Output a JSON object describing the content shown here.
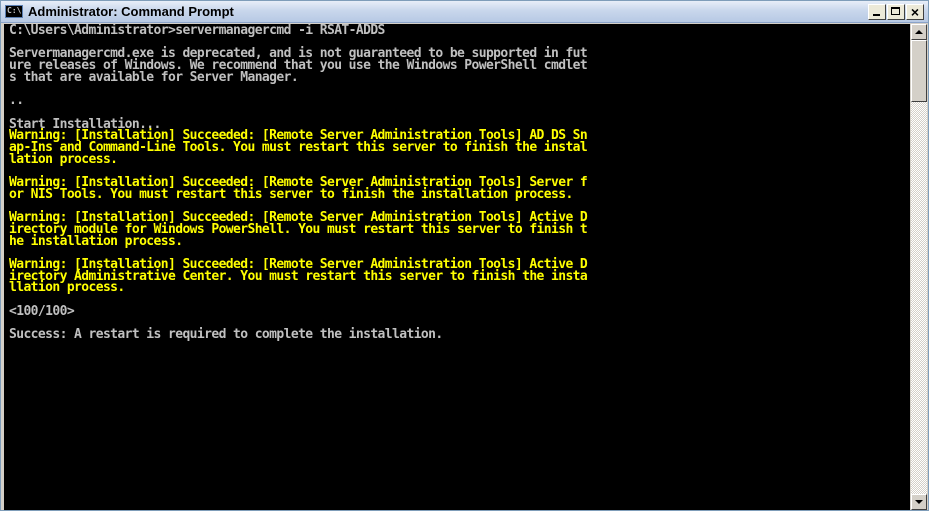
{
  "window": {
    "title": "Administrator: Command Prompt",
    "icon_text": "C:\\"
  },
  "console": {
    "lines": [
      {
        "text": "C:\\Users\\Administrator>servermanagercmd -i RSAT-ADDS",
        "color": "white"
      },
      {
        "text": "",
        "color": "white"
      },
      {
        "text": "Servermanagercmd.exe is deprecated, and is not guaranteed to be supported in fut",
        "color": "white"
      },
      {
        "text": "ure releases of Windows. We recommend that you use the Windows PowerShell cmdlet",
        "color": "white"
      },
      {
        "text": "s that are available for Server Manager.",
        "color": "white"
      },
      {
        "text": "",
        "color": "white"
      },
      {
        "text": "..",
        "color": "white"
      },
      {
        "text": "",
        "color": "white"
      },
      {
        "text": "Start Installation...",
        "color": "white"
      },
      {
        "text": "Warning: [Installation] Succeeded: [Remote Server Administration Tools] AD DS Sn",
        "color": "yellow"
      },
      {
        "text": "ap-Ins and Command-Line Tools. You must restart this server to finish the instal",
        "color": "yellow"
      },
      {
        "text": "lation process.",
        "color": "yellow"
      },
      {
        "text": "",
        "color": "white"
      },
      {
        "text": "Warning: [Installation] Succeeded: [Remote Server Administration Tools] Server f",
        "color": "yellow"
      },
      {
        "text": "or NIS Tools. You must restart this server to finish the installation process.",
        "color": "yellow"
      },
      {
        "text": "",
        "color": "white"
      },
      {
        "text": "Warning: [Installation] Succeeded: [Remote Server Administration Tools] Active D",
        "color": "yellow"
      },
      {
        "text": "irectory module for Windows PowerShell. You must restart this server to finish t",
        "color": "yellow"
      },
      {
        "text": "he installation process.",
        "color": "yellow"
      },
      {
        "text": "",
        "color": "white"
      },
      {
        "text": "Warning: [Installation] Succeeded: [Remote Server Administration Tools] Active D",
        "color": "yellow"
      },
      {
        "text": "irectory Administrative Center. You must restart this server to finish the insta",
        "color": "yellow"
      },
      {
        "text": "llation process.",
        "color": "yellow"
      },
      {
        "text": "",
        "color": "white"
      },
      {
        "text": "<100/100>",
        "color": "white"
      },
      {
        "text": "",
        "color": "white"
      },
      {
        "text": "Success: A restart is required to complete the installation.",
        "color": "white"
      }
    ]
  },
  "colors": {
    "console_bg": "#000000",
    "console_text": "#c0c0c0",
    "warning_text": "#ffff00"
  },
  "icons": {
    "window_icon": "cmd-icon",
    "minimize": "minimize-icon",
    "maximize": "maximize-icon",
    "close": "close-icon",
    "scroll_up": "arrow-up-icon",
    "scroll_down": "arrow-down-icon"
  }
}
